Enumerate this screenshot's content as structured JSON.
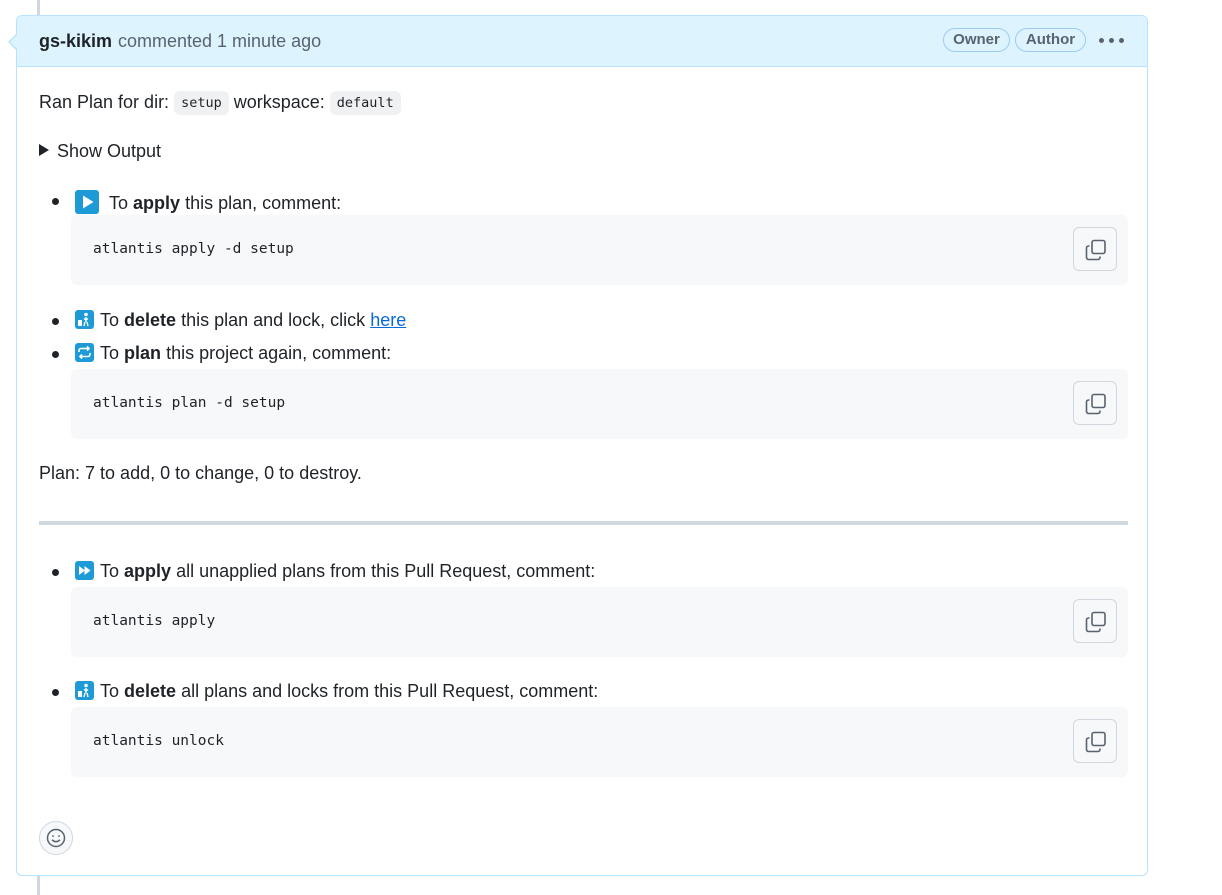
{
  "comment": {
    "author": "gs-kikim",
    "meta": "commented 1 minute ago",
    "badges": {
      "owner": "Owner",
      "author": "Author"
    },
    "intro": {
      "prefix": "Ran Plan for dir:",
      "dir": "setup",
      "workspace_label": "workspace:",
      "workspace": "default"
    },
    "details_summary": "Show Output",
    "items": [
      {
        "icon": "play-icon",
        "pre": "To",
        "bold": "apply",
        "post": "this plan, comment:"
      },
      {
        "icon": "put-litter-in-its-place-icon",
        "pre": "To",
        "bold": "delete",
        "post": "this plan and lock, click",
        "link": "here"
      },
      {
        "icon": "repeat-icon",
        "pre": "To",
        "bold": "plan",
        "post": "this project again, comment:"
      },
      {
        "icon": "fast-forward-icon",
        "pre": "To",
        "bold": "apply",
        "post": "all unapplied plans from this Pull Request, comment:"
      },
      {
        "icon": "put-litter-in-its-place-icon",
        "pre": "To",
        "bold": "delete",
        "post": "all plans and locks from this Pull Request, comment:"
      }
    ],
    "code_blocks": [
      "atlantis apply -d setup",
      "atlantis plan -d setup",
      "atlantis apply",
      "atlantis unlock"
    ],
    "plan_summary": "Plan: 7 to add, 0 to change, 0 to destroy.",
    "colors": {
      "header_bg": "#ddf4ff",
      "border": "#b6e3ff",
      "emoji_blue": "#1e9bd7",
      "link": "#0969da"
    }
  }
}
